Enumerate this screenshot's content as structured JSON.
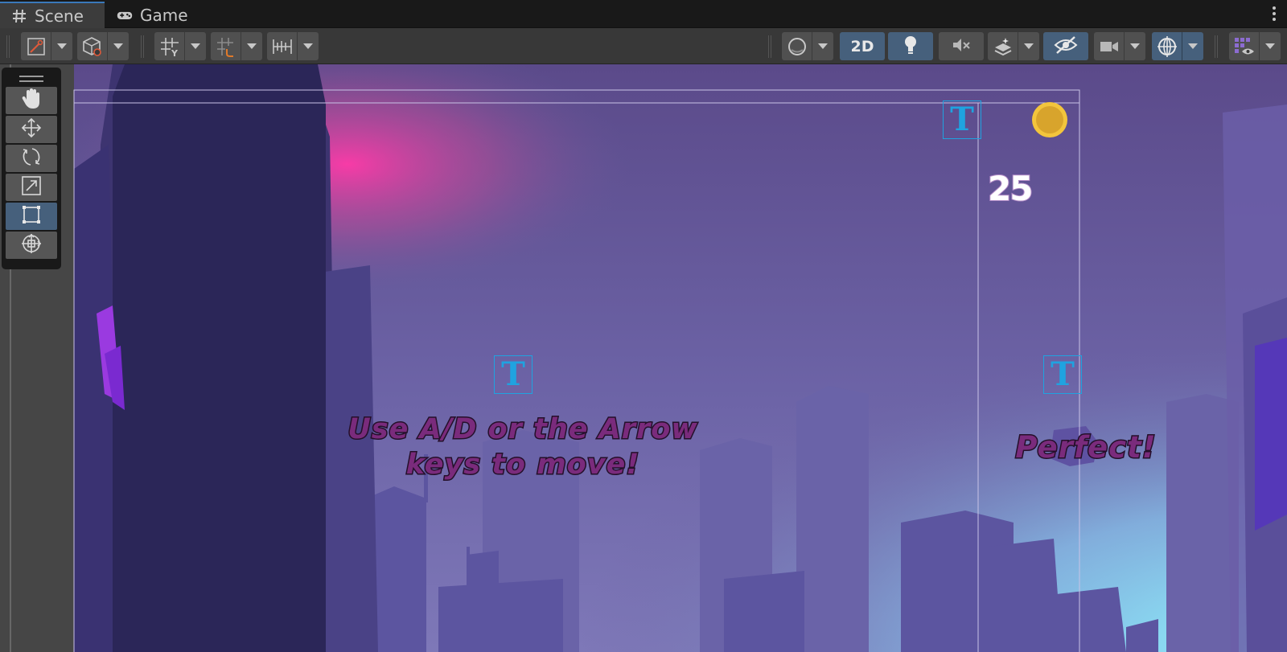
{
  "tabs": [
    {
      "label": "Scene",
      "icon": "hash-grid-icon",
      "active": true
    },
    {
      "label": "Game",
      "icon": "gamepad-icon",
      "active": false
    }
  ],
  "toolbar": {
    "left_tools": [
      "draw-mode-icon",
      "scene-camera-icon",
      "grid-snap-icon",
      "increment-snap-icon",
      "ruler-icon"
    ],
    "shading_icon": "shading-sphere-icon",
    "mode_2d_label": "2D",
    "lighting_icon": "lightbulb-icon",
    "audio_icon": "audio-mute-icon",
    "effects_icon": "effects-layers-icon",
    "visibility_icon": "hidden-eye-icon",
    "camera_icon": "camera-icon",
    "gizmos_icon": "gizmos-globe-icon",
    "layers_icon": "scene-visibility-grid-icon"
  },
  "tools_overlay": [
    "hand-tool",
    "move-tool",
    "rotate-tool",
    "scale-tool",
    "rect-tool",
    "transform-tool"
  ],
  "active_tool": "rect-tool",
  "game_ui": {
    "tip_line1": "Use A/D or the Arrow",
    "tip_line2": "keys to move!",
    "perfect_text": "Perfect!",
    "score": "25",
    "gizmo_glyph": "T"
  },
  "colors": {
    "accent_blue": "#46607c",
    "gizmo_blue": "#1fa3e0",
    "text_purple": "#7a2b7c",
    "coin_gold": "#e9b122"
  }
}
